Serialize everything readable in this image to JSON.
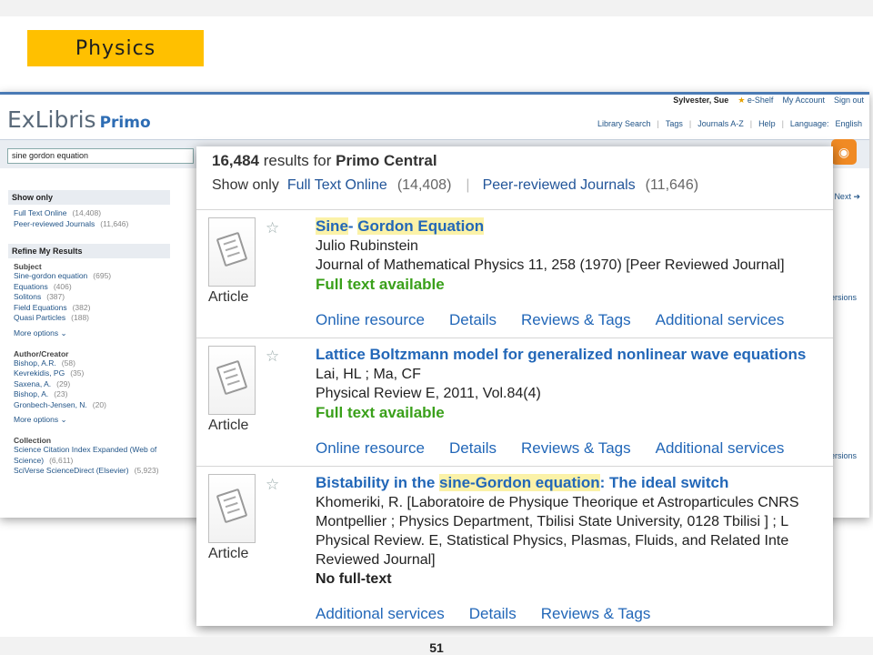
{
  "slide": {
    "title": "Physics",
    "page_number": "51"
  },
  "background": {
    "user_bar": {
      "user": "Sylvester, Sue",
      "eshelf": "e-Shelf",
      "my_account": "My Account",
      "sign_out": "Sign out"
    },
    "logo": {
      "main": "ExLibris",
      "product": "Primo"
    },
    "top_nav": [
      "Library Search",
      "Tags",
      "Journals A-Z",
      "Help",
      "Language:",
      "English"
    ],
    "search": {
      "value": "sine gordon equation"
    },
    "next_label": "Next",
    "versions_label": "ersions",
    "sidebar": {
      "show_only": {
        "heading": "Show only",
        "items": [
          {
            "label": "Full Text Online",
            "count": "(14,408)"
          },
          {
            "label": "Peer-reviewed Journals",
            "count": "(11,646)"
          }
        ]
      },
      "refine": {
        "heading": "Refine My Results",
        "subject_label": "Subject",
        "subject_items": [
          {
            "label": "Sine-gordon equation",
            "count": "(695)"
          },
          {
            "label": "Equations",
            "count": "(406)"
          },
          {
            "label": "Solitons",
            "count": "(387)"
          },
          {
            "label": "Field Equations",
            "count": "(382)"
          },
          {
            "label": "Quasi Particles",
            "count": "(188)"
          }
        ],
        "more": "More options",
        "author_label": "Author/Creator",
        "author_items": [
          {
            "label": "Bishop, A.R.",
            "count": "(58)"
          },
          {
            "label": "Kevrekidis, PG",
            "count": "(35)"
          },
          {
            "label": "Saxena, A.",
            "count": "(29)"
          },
          {
            "label": "Bishop, A.",
            "count": "(23)"
          },
          {
            "label": "Gronbech-Jensen, N.",
            "count": "(20)"
          }
        ],
        "collection_label": "Collection",
        "collection_items": [
          {
            "label": "Science Citation Index Expanded (Web of Science)",
            "count": "(6,611)"
          },
          {
            "label": "SciVerse ScienceDirect (Elsevier)",
            "count": "(5,923)"
          }
        ]
      }
    }
  },
  "front": {
    "results_count": "16,484",
    "results_text": "results for",
    "scope": "Primo Central",
    "show_only_label": "Show only",
    "filters": [
      {
        "label": "Full Text Online",
        "count": "(14,408)"
      },
      {
        "label": "Peer-reviewed Journals",
        "count": "(11,646)"
      }
    ],
    "results": [
      {
        "type": "Article",
        "title_parts": [
          {
            "text": "Sine",
            "hl": true
          },
          {
            "text": "- ",
            "hl": false
          },
          {
            "text": "Gordon Equation",
            "hl": true
          }
        ],
        "lines": [
          "Julio Rubinstein",
          "Journal of Mathematical Physics 11, 258 (1970) [Peer Reviewed Journal]"
        ],
        "availability": "Full text available",
        "actions": [
          "Online resource",
          "Details",
          "Reviews & Tags",
          "Additional services"
        ]
      },
      {
        "type": "Article",
        "title_parts": [
          {
            "text": "Lattice Boltzmann model for generalized nonlinear wave equations",
            "hl": false
          }
        ],
        "lines": [
          "Lai, HL ; Ma, CF",
          "Physical Review E, 2011, Vol.84(4)"
        ],
        "availability": "Full text available",
        "actions": [
          "Online resource",
          "Details",
          "Reviews & Tags",
          "Additional services"
        ]
      },
      {
        "type": "Article",
        "title_parts": [
          {
            "text": "Bistability in the ",
            "hl": false
          },
          {
            "text": "sine-Gordon equation",
            "hl": true
          },
          {
            "text": ": The ideal switch",
            "hl": false
          }
        ],
        "lines": [
          "Khomeriki, R. [Laboratoire de Physique Theorique et Astroparticules CNRS",
          "Montpellier ; Physics Department, Tbilisi State University, 0128 Tbilisi ] ; L",
          "Physical Review. E, Statistical Physics, Plasmas, Fluids, and Related Inte",
          "Reviewed Journal]"
        ],
        "availability": "No full-text",
        "actions": [
          "Additional services",
          "Details",
          "Reviews & Tags"
        ]
      }
    ]
  }
}
